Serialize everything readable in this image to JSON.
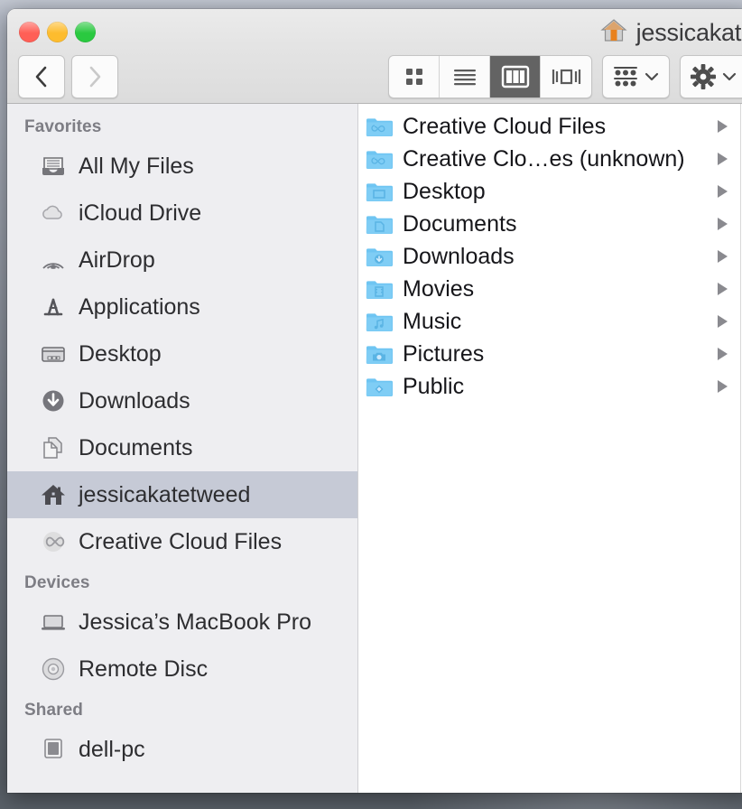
{
  "window": {
    "title": "jessicakate",
    "home_icon": "home-icon",
    "traffic_lights": [
      {
        "name": "close-button",
        "color": "#ff5f56"
      },
      {
        "name": "minimize-button",
        "color": "#fdbc2e"
      },
      {
        "name": "maximize-button",
        "color": "#2ac940"
      }
    ]
  },
  "toolbar": {
    "back_label": "Back",
    "forward_label": "Forward",
    "back_icon": "chevron-left-icon",
    "forward_icon": "chevron-right-icon",
    "view_modes": [
      {
        "id": "icon",
        "label": "Icon View",
        "icon": "grid-icon",
        "selected": false
      },
      {
        "id": "list",
        "label": "List View",
        "icon": "list-icon",
        "selected": false
      },
      {
        "id": "column",
        "label": "Column View",
        "icon": "columns-icon",
        "selected": true
      },
      {
        "id": "coverflow",
        "label": "Cover Flow",
        "icon": "coverflow-icon",
        "selected": false
      }
    ],
    "arrange_label": "Arrange By",
    "arrange_icon": "arrange-grid-icon",
    "action_label": "Action",
    "action_icon": "gear-icon",
    "chevron_icon": "chevron-down-icon",
    "selected_color": "#636363"
  },
  "sidebar": {
    "sections": [
      {
        "header": "Favorites",
        "items": [
          {
            "label": "All My Files",
            "icon": "all-my-files-icon",
            "selected": false
          },
          {
            "label": "iCloud Drive",
            "icon": "icloud-icon",
            "selected": false
          },
          {
            "label": "AirDrop",
            "icon": "airdrop-icon",
            "selected": false
          },
          {
            "label": "Applications",
            "icon": "applications-icon",
            "selected": false
          },
          {
            "label": "Desktop",
            "icon": "desktop-icon",
            "selected": false
          },
          {
            "label": "Downloads",
            "icon": "downloads-icon",
            "selected": false
          },
          {
            "label": "Documents",
            "icon": "documents-icon",
            "selected": false
          },
          {
            "label": "jessicakatetweed",
            "icon": "home-icon",
            "selected": true
          },
          {
            "label": "Creative Cloud Files",
            "icon": "creative-cloud-icon",
            "selected": false
          }
        ]
      },
      {
        "header": "Devices",
        "items": [
          {
            "label": "Jessica’s MacBook Pro",
            "icon": "laptop-icon",
            "selected": false
          },
          {
            "label": "Remote Disc",
            "icon": "disc-icon",
            "selected": false
          }
        ]
      },
      {
        "header": "Shared",
        "items": [
          {
            "label": "dell-pc",
            "icon": "pc-icon",
            "selected": false
          }
        ]
      }
    ],
    "selection_color": "#c6cad6"
  },
  "column_view": {
    "items": [
      {
        "label": "Creative Cloud Files",
        "icon": "folder-creative-cloud-icon",
        "has_children": true
      },
      {
        "label": "Creative Clo…es (unknown)",
        "icon": "folder-creative-cloud-icon",
        "has_children": true
      },
      {
        "label": "Desktop",
        "icon": "folder-desktop-icon",
        "has_children": true
      },
      {
        "label": "Documents",
        "icon": "folder-documents-icon",
        "has_children": true
      },
      {
        "label": "Downloads",
        "icon": "folder-downloads-icon",
        "has_children": true
      },
      {
        "label": "Movies",
        "icon": "folder-movies-icon",
        "has_children": true
      },
      {
        "label": "Music",
        "icon": "folder-music-icon",
        "has_children": true
      },
      {
        "label": "Pictures",
        "icon": "folder-pictures-icon",
        "has_children": true
      },
      {
        "label": "Public",
        "icon": "folder-public-icon",
        "has_children": true
      }
    ],
    "folder_color": "#6fc5f2",
    "arrow_icon": "disclosure-triangle-icon"
  }
}
